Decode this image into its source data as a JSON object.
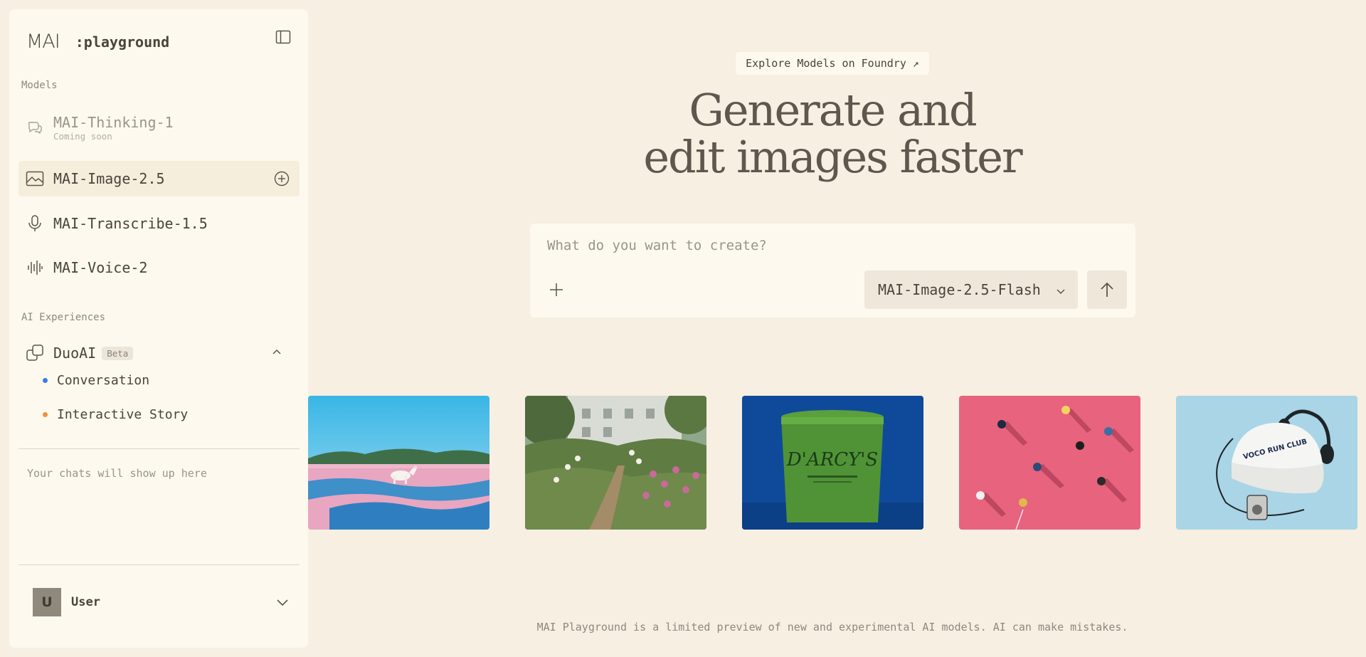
{
  "brand": {
    "logo": "MAI",
    "name": ":playground"
  },
  "sidebar": {
    "models_label": "Models",
    "models": [
      {
        "name": "MAI-Thinking-1",
        "sub": "Coming soon",
        "icon": "chat-bubbles-icon",
        "disabled": true
      },
      {
        "name": "MAI-Image-2.5",
        "icon": "image-icon",
        "active": true
      },
      {
        "name": "MAI-Transcribe-1.5",
        "icon": "microphone-icon"
      },
      {
        "name": "MAI-Voice-2",
        "icon": "waveform-icon"
      }
    ],
    "experiences_label": "AI Experiences",
    "duo": {
      "name": "DuoAI",
      "badge": "Beta",
      "items": [
        {
          "label": "Conversation",
          "color": "#3b7be8"
        },
        {
          "label": "Interactive Story",
          "color": "#f0913a"
        }
      ]
    },
    "empty_chats": "Your chats will show up here",
    "user": {
      "initial": "U",
      "name": "User"
    }
  },
  "main": {
    "explore_label": "Explore Models on Foundry ↗",
    "hero_line1": "Generate and",
    "hero_line2": "edit images faster",
    "prompt_placeholder": "What do you want to create?",
    "selected_model": "MAI-Image-2.5-Flash",
    "gallery": [
      {
        "label": "horse-landscape"
      },
      {
        "label": "garden"
      },
      {
        "label": "ice-cream-tub",
        "text": "D'ARCY'S"
      },
      {
        "label": "aerial-people"
      },
      {
        "label": "cap-headphones",
        "text": "VOCO RUN CLUB"
      }
    ],
    "disclaimer": "MAI Playground is a limited preview of new and experimental AI models. AI can make mistakes."
  },
  "colors": {
    "background": "#f6efe2",
    "panel": "#fdf9ee",
    "active": "#f6eedd",
    "text": "#4a443c"
  }
}
